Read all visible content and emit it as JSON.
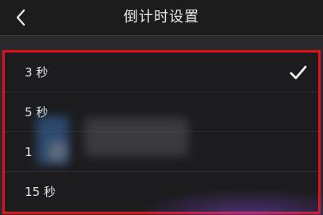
{
  "header": {
    "back_icon": "chevron-left-icon",
    "title": "倒计时设置"
  },
  "options": [
    {
      "label": "3 秒",
      "selected": true
    },
    {
      "label": "5 秒",
      "selected": false
    },
    {
      "label": "1",
      "selected": false
    },
    {
      "label": "15 秒",
      "selected": false
    }
  ],
  "colors": {
    "highlight_border": "#e0111b",
    "background": "#1c1c1e",
    "text": "#e6e6e8"
  }
}
